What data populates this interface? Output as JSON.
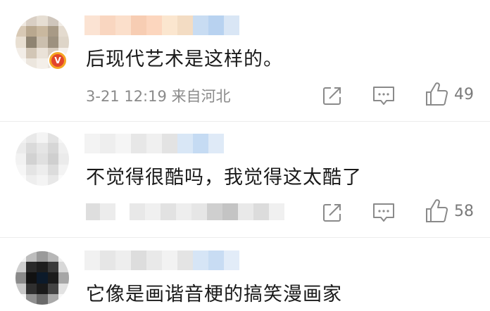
{
  "comments": [
    {
      "text": "后现代艺术是这样的。",
      "time_location": "3-21 12:19 来自河北",
      "likes": "49",
      "verified_badge": "V"
    },
    {
      "text": "不觉得很酷吗，我觉得这太酷了",
      "likes": "58"
    },
    {
      "text": "它像是画谐音梗的搞笑漫画家"
    }
  ],
  "icons": {
    "share": "share-icon",
    "comment": "comment-icon",
    "like": "thumbs-up-icon"
  },
  "colors": {
    "text": "#1a1a1a",
    "meta": "#8a8a8a",
    "icon": "#8a8a8a",
    "badge_outer": "#f5a623",
    "badge_inner": "#e2452b"
  }
}
